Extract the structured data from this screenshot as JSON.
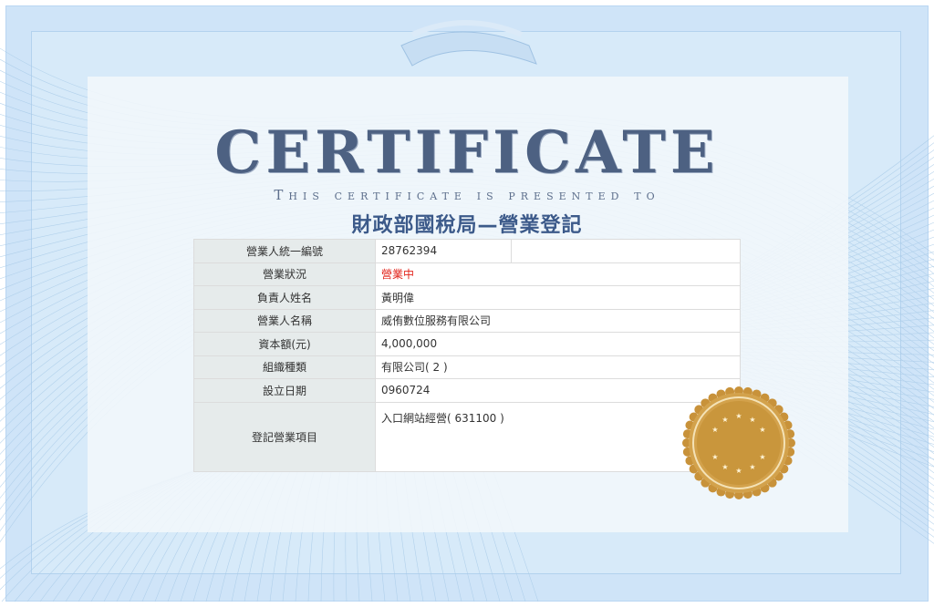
{
  "certificate": {
    "title": "CERTIFICATE",
    "subtitle": "This certificate is presented to",
    "heading": "財政部國稅局—營業登記"
  },
  "info_table": {
    "rows": [
      {
        "label": "營業人統一編號",
        "value": "28762394"
      },
      {
        "label": "營業狀況",
        "value": "營業中"
      },
      {
        "label": "負責人姓名",
        "value": "黃明偉"
      },
      {
        "label": "營業人名稱",
        "value": "威侑數位服務有限公司"
      },
      {
        "label": "資本額(元)",
        "value": "4,000,000"
      },
      {
        "label": "組織種類",
        "value": "有限公司( 2 )"
      },
      {
        "label": "設立日期",
        "value": "0960724"
      },
      {
        "label": "登記營業項目",
        "value": "入口網站經營( 631100 )"
      }
    ]
  },
  "colors": {
    "title": "#4d6182",
    "heading": "#3c5a8a",
    "status_red": "#e2231a",
    "seal_gold": "#c9963c",
    "background_blue": "#cfe4f8"
  }
}
